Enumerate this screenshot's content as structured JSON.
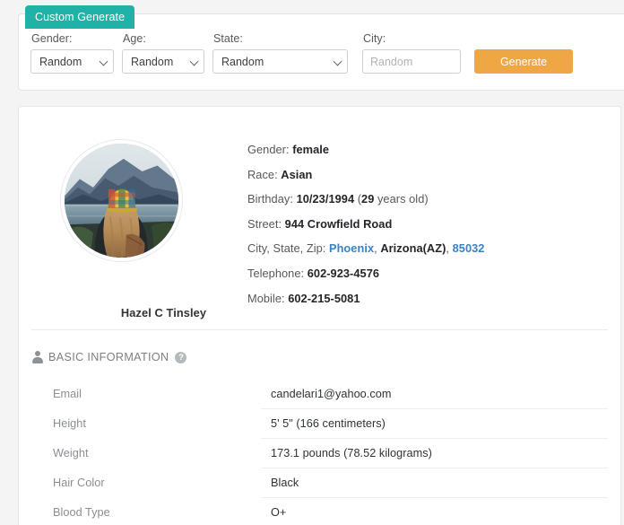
{
  "generator": {
    "tab_label": "Custom Generate",
    "fields": [
      {
        "label": "Gender:",
        "value": "Random",
        "name": "gender"
      },
      {
        "label": "Age:",
        "value": "Random",
        "name": "age"
      },
      {
        "label": "State:",
        "value": "Random",
        "name": "state"
      }
    ],
    "city": {
      "label": "City:",
      "placeholder": "Random",
      "value": ""
    },
    "generate_label": "Generate"
  },
  "profile": {
    "name": "Hazel C Tinsley",
    "avatar_alt": "woman-from-behind-plaid-cap-lake-photo",
    "details": {
      "gender_label": "Gender:",
      "gender_value": "female",
      "race_label": "Race:",
      "race_value": "Asian",
      "birthday_label": "Birthday:",
      "birthday_value": "10/23/1994",
      "birthday_age_number": "29",
      "birthday_age_suffix": " years old)",
      "birthday_age_prefix": "(",
      "street_label": "Street:",
      "street_value": "944 Crowfield Road",
      "csz_label": "City, State, Zip:",
      "city_value": "Phoenix",
      "state_value": "Arizona(AZ)",
      "zip_value": "85032",
      "telephone_label": "Telephone:",
      "telephone_value": "602-923-4576",
      "mobile_label": "Mobile:",
      "mobile_value": "602-215-5081"
    }
  },
  "basic_information": {
    "title": "BASIC INFORMATION",
    "help_glyph": "?",
    "rows": [
      {
        "label": "Email",
        "value": "candelari1@yahoo.com"
      },
      {
        "label": "Height",
        "value": "5' 5\" (166 centimeters)"
      },
      {
        "label": "Weight",
        "value": "173.1 pounds (78.52 kilograms)"
      },
      {
        "label": "Hair Color",
        "value": "Black"
      },
      {
        "label": "Blood Type",
        "value": "O+"
      }
    ]
  },
  "colors": {
    "tab_teal": "#20b2a6",
    "generate_orange": "#efa645",
    "link_blue": "#3a82c4",
    "page_bg": "#f4f4f4"
  }
}
